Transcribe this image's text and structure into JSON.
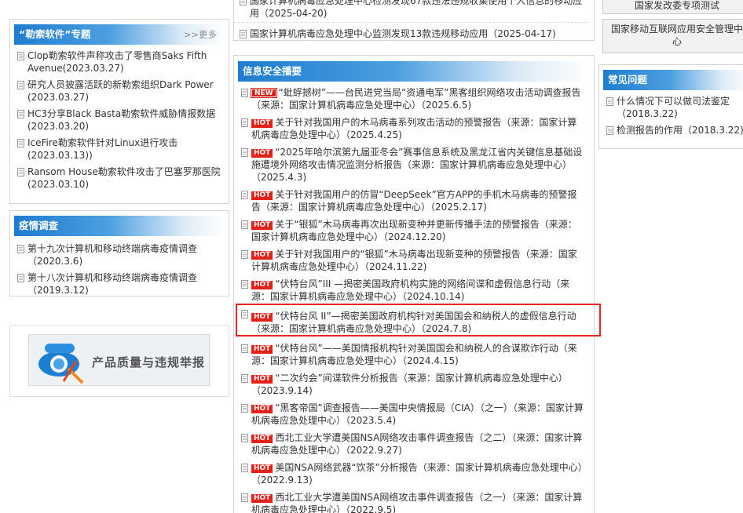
{
  "left": {
    "ransom": {
      "title": "“勒索软件”专题",
      "more": ">>更多",
      "items": [
        "Clop勒索软件声称攻击了零售商Saks Fifth Avenue(2023.03.27)",
        "研究人员披露活跃的新勒索组织Dark Power (2023.03.27)",
        "HC3分享Black Basta勒索软件威胁情报数据(2023.03.20)",
        "IceFire勒索软件针对Linux进行攻击(2023.03.13))",
        "Ransom House勒索软件攻击了巴塞罗那医院(2023.03.10)"
      ]
    },
    "survey": {
      "title": "疫情调查",
      "items": [
        "第十九次计算机和移动终端病毒疫情调查（2020.3.6)",
        "第十八次计算机和移动终端病毒疫情调查（2019.3.12)"
      ]
    },
    "banner": {
      "text": "产品质量与违规举报"
    }
  },
  "middle": {
    "top_items": [
      "国家计算机病毒应急处理中心检测发现67款违法违规收集使用个人信息的移动应用（2025-04-20)",
      "国家计算机病毒应急处理中心监测发现13款违规移动应用（2025-04-17)"
    ],
    "digest": {
      "title": "信息安全播要",
      "items": [
        {
          "tag": "NEW",
          "text": "“蚍蜉撼树”——台民进党当局“资通电军”黑客组织网络攻击活动调查报告（来源：国家计算机病毒应急处理中心）（2025.6.5)"
        },
        {
          "tag": "HOT",
          "text": "关于针对我国用户的木马病毒系列攻击活动的预警报告（来源：国家计算机病毒应急处理中心）（2025.4.25)"
        },
        {
          "tag": "HOT",
          "text": "“2025年哈尔滨第九届亚冬会”赛事信息系统及黑龙江省内关键信息基础设施遭境外网络攻击情况监测分析报告（来源：国家计算机病毒应急处理中心）（2025.4.3)"
        },
        {
          "tag": "HOT",
          "text": "关于针对我国用户的仿冒“DeepSeek”官方APP的手机木马病毒的预警报告（来源：国家计算机病毒应急处理中心）（2025.2.17)"
        },
        {
          "tag": "HOT",
          "text": "关于“银狐”木马病毒再次出现新变种并更新传播手法的预警报告（来源：国家计算机病毒应急处理中心）（2024.12.20)"
        },
        {
          "tag": "HOT",
          "text": "关于针对我国用户的“银狐”木马病毒出现新变种的预警报告（来源：国家计算机病毒应急处理中心）（2024.11.22)"
        },
        {
          "tag": "HOT",
          "text": "“伏特台风”III —揭密美国政府机构实施的网络间谍和虚假信息行动（来源：国家计算机病毒应急处理中心）（2024.10.14)"
        },
        {
          "tag": "HOT",
          "text": "“伏特台风 II”—揭密美国政府机构针对美国国会和纳税人的虚假信息行动（来源：国家计算机病毒应急处理中心）（2024.7.8)"
        },
        {
          "tag": "HOT",
          "text": "“伏特台风”——美国情报机构针对美国国会和纳税人的合谋欺诈行动（来源：国家计算机病毒应急处理中心）（2024.4.15)"
        },
        {
          "tag": "HOT",
          "text": "“二次约会”间谍软件分析报告（来源：国家计算机病毒应急处理中心）（2023.9.14)"
        },
        {
          "tag": "HOT",
          "text": "“黑客帝国”调查报告——美国中央情报局（CIA）（之一）（来源：国家计算机病毒应急处理中心）（2023.5.4)"
        },
        {
          "tag": "HOT",
          "text": "西北工业大学遭美国NSA网络攻击事件调查报告（之二）（来源：国家计算机病毒应急处理中心）（2022.9.27)"
        },
        {
          "tag": "HOT",
          "text": "美国NSA网络武器“饮茶”分析报告（来源：国家计算机病毒应急处理中心）（2022.9.13)"
        },
        {
          "tag": "HOT",
          "text": "西北工业大学遭美国NSA网络攻击事件调查报告（之一）（来源：国家计算机病毒应急处理中心）（2022.9.5)"
        }
      ]
    }
  },
  "right": {
    "buttons": [
      "国家发改委专项测试",
      "国家移动互联网应用安全管理中心"
    ],
    "faq": {
      "title": "常见问题",
      "items": [
        "什么情况下可以做司法鉴定（2018.3.22)",
        "检测报告的作用（2018.3.22)"
      ]
    }
  }
}
